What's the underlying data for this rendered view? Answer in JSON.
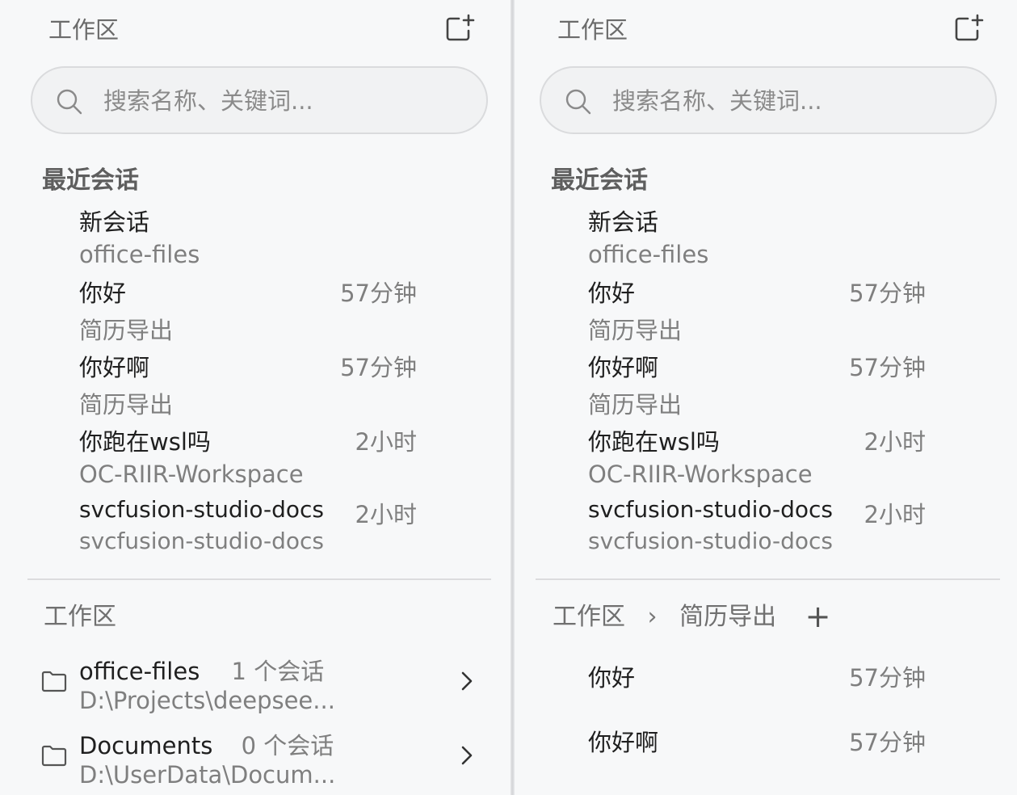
{
  "left": {
    "header_title": "工作区",
    "search_placeholder": "搜索名称、关键词...",
    "recent_title": "最近会话",
    "sessions": [
      {
        "title": "新会话",
        "workspace": "office-files",
        "time": ""
      },
      {
        "title": "你好",
        "workspace": "简历导出",
        "time": "57分钟"
      },
      {
        "title": "你好啊",
        "workspace": "简历导出",
        "time": "57分钟"
      },
      {
        "title": "你跑在wsl吗",
        "workspace": "OC-RIIR-Workspace",
        "time": "2小时"
      },
      {
        "title": "svcfusion-studio-docs",
        "workspace": "svcfusion-studio-docs",
        "time": "2小时"
      }
    ],
    "workspaces_title": "工作区",
    "workspaces": [
      {
        "name": "office-files",
        "count": "1 个会话",
        "path": "D:\\Projects\\deepsee..."
      },
      {
        "name": "Documents",
        "count": "0 个会话",
        "path": "D:\\UserData\\Docum..."
      }
    ]
  },
  "right": {
    "header_title": "工作区",
    "search_placeholder": "搜索名称、关键词...",
    "recent_title": "最近会话",
    "sessions": [
      {
        "title": "新会话",
        "workspace": "office-files",
        "time": ""
      },
      {
        "title": "你好",
        "workspace": "简历导出",
        "time": "57分钟"
      },
      {
        "title": "你好啊",
        "workspace": "简历导出",
        "time": "57分钟"
      },
      {
        "title": "你跑在wsl吗",
        "workspace": "OC-RIIR-Workspace",
        "time": "2小时"
      },
      {
        "title": "svcfusion-studio-docs",
        "workspace": "svcfusion-studio-docs",
        "time": "2小时"
      }
    ],
    "breadcrumb": {
      "root": "工作区",
      "separator": "›",
      "current": "简历导出",
      "add": "+"
    },
    "workspace_sessions": [
      {
        "title": "你好",
        "time": "57分钟"
      },
      {
        "title": "你好啊",
        "time": "57分钟"
      }
    ]
  },
  "icons": {
    "search": "search-icon",
    "new_chat": "new-chat-icon",
    "folder": "folder-icon",
    "chevron": "chevron-right-icon"
  }
}
